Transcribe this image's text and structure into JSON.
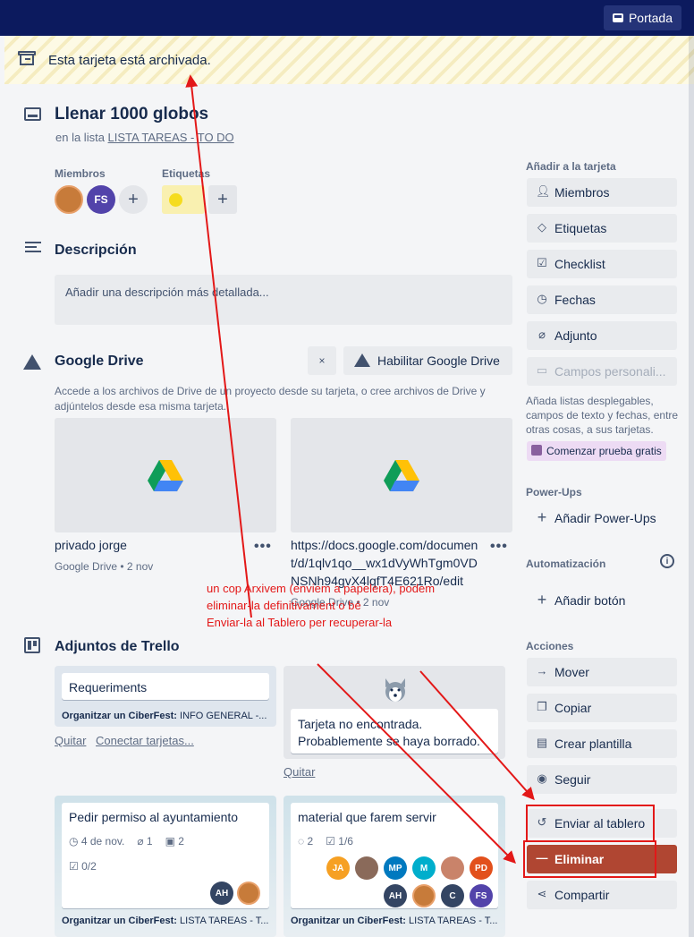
{
  "topbar": {
    "portada_label": "Portada"
  },
  "banner": {
    "text": "Esta tarjeta está archivada.",
    "icon": "archive-icon"
  },
  "card": {
    "title": "Llenar 1000 globos",
    "in_list_prefix": "en la lista",
    "list_name": "LISTA TAREAS - TO DO"
  },
  "members": {
    "label": "Miembros",
    "avatars": [
      {
        "initials": "",
        "color": "#c77b3a"
      },
      {
        "initials": "FS",
        "color": "#5243aa"
      }
    ]
  },
  "labels_section": {
    "label": "Etiquetas",
    "label_color": "#f5dc1e"
  },
  "description": {
    "title": "Descripción",
    "placeholder": "Añadir una descripción más detallada..."
  },
  "gdrive": {
    "title": "Google Drive",
    "close": "×",
    "enable_label": "Habilitar Google Drive",
    "desc": "Accede a los archivos de Drive de un proyecto desde su tarjeta, o cree archivos de Drive y adjúntelos desde esa misma tarjeta.",
    "files": [
      {
        "name": "privado jorge",
        "meta": "Google Drive • 2 nov"
      },
      {
        "name": "https://docs.google.com/document/d/1qlv1qo__wx1dVyWhTgm0VDNSNh94gvX4lqfT4E621Ro/edit",
        "name_lines": [
          "https://docs.google.com/documen",
          "t/d/1qlv1qo__wx1dVyWhTgm0VD",
          "NSNh94gvX4lqfT4E621Ro/edit"
        ],
        "meta": "Google Drive • 2 nov"
      }
    ]
  },
  "trello": {
    "title": "Adjuntos de Trello",
    "cards": [
      {
        "title": "Requeriments",
        "board_bold": "Organitzar un CiberFest:",
        "board_rest": " INFO GENERAL -...",
        "remove": "Quitar",
        "connect": "Conectar tarjetas..."
      },
      {
        "title_line1": "Tarjeta no encontrada.",
        "title_line2": "Probablemente se haya borrado.",
        "remove": "Quitar"
      },
      {
        "title": "Pedir permiso al ayuntamiento",
        "date": "4 de nov.",
        "attachments": "1",
        "cards": "2",
        "checklist": "0/2",
        "board_bold": "Organitzar un CiberFest:",
        "board_rest": " LISTA TAREAS - T...",
        "avatars": [
          {
            "initials": "AH",
            "color": "#344563"
          },
          {
            "initials": "",
            "color": "#c77b3a"
          }
        ]
      },
      {
        "title": "material que farem servir",
        "comments": "2",
        "checklist": "1/6",
        "board_bold": "Organitzar un CiberFest:",
        "board_rest": " LISTA TAREAS - T...",
        "avatars_row1": [
          {
            "initials": "JA",
            "color": "#f6a023"
          },
          {
            "initials": "",
            "color": "#8a6a5a"
          },
          {
            "initials": "MP",
            "color": "#0079bf"
          },
          {
            "initials": "M",
            "color": "#00aecc"
          },
          {
            "initials": "",
            "color": "#c9836a"
          },
          {
            "initials": "PD",
            "color": "#e2501c"
          }
        ],
        "avatars_row2": [
          {
            "initials": "AH",
            "color": "#344563"
          },
          {
            "initials": "",
            "color": "#c77b3a"
          },
          {
            "initials": "C",
            "color": "#344563"
          },
          {
            "initials": "FS",
            "color": "#5243aa"
          }
        ]
      }
    ]
  },
  "sidebar": {
    "add_label": "Añadir a la tarjeta",
    "add_items": [
      {
        "label": "Miembros",
        "icon": "user-icon"
      },
      {
        "label": "Etiquetas",
        "icon": "tag-icon"
      },
      {
        "label": "Checklist",
        "icon": "checkbox-icon"
      },
      {
        "label": "Fechas",
        "icon": "clock-icon"
      },
      {
        "label": "Adjunto",
        "icon": "paperclip-icon"
      },
      {
        "label": "Campos personali...",
        "icon": "fields-icon"
      }
    ],
    "fields_note": "Añada listas desplegables, campos de texto y fechas, entre otras cosas, a sus tarjetas.",
    "trial_label": "Comenzar prueba gratis",
    "powerups_label": "Power-Ups",
    "add_powerups": "Añadir Power-Ups",
    "automation_label": "Automatización",
    "add_button": "Añadir botón",
    "actions_label": "Acciones",
    "actions": [
      {
        "label": "Mover",
        "icon": "arrow-right-icon"
      },
      {
        "label": "Copiar",
        "icon": "copy-icon"
      },
      {
        "label": "Crear plantilla",
        "icon": "template-icon"
      },
      {
        "label": "Seguir",
        "icon": "eye-icon"
      },
      {
        "label": "Enviar al tablero",
        "icon": "restore-icon"
      },
      {
        "label": "Eliminar",
        "icon": "minus-icon"
      },
      {
        "label": "Compartir",
        "icon": "share-icon"
      }
    ]
  },
  "annotation": {
    "line1": "un cop Arxivem (enviem a papelera), podem",
    "line2": "eliminar-la definitivament o bé",
    "line3": "Enviar-la al Tablero per recuperar-la",
    "color": "#e31818"
  }
}
